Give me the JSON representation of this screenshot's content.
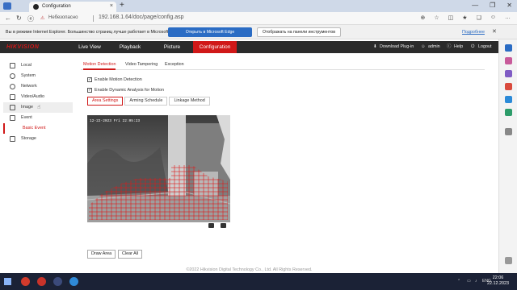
{
  "browser": {
    "tab_title": "Configuration",
    "tab_close": "×",
    "new_tab": "+",
    "window_controls": [
      "—",
      "❐",
      "✕"
    ],
    "security_label": "Небезопасно",
    "url": "192.168.1.64/doc/page/config.asp"
  },
  "ie_infobar": {
    "message": "Вы в режиме Internet Explorer. Большинство страниц лучше работает в Microsoft Edge.",
    "open_in_edge": "Открыть в Microsoft Edge",
    "show_on_toolbar": "Отображать на панели инструментов",
    "more_link": "Подробнее",
    "close": "✕"
  },
  "app": {
    "logo": "HIKVISION",
    "menu": [
      {
        "label": "Live View"
      },
      {
        "label": "Playback"
      },
      {
        "label": "Picture"
      },
      {
        "label": "Configuration"
      }
    ],
    "right": {
      "download_plugin": "Download Plug-in",
      "user": "admin",
      "help": "Help",
      "logout": "Logout"
    },
    "sidebar": [
      {
        "label": "Local"
      },
      {
        "label": "System"
      },
      {
        "label": "Network"
      },
      {
        "label": "Video/Audio"
      },
      {
        "label": "Image"
      },
      {
        "label": "Event"
      },
      {
        "label": "Basic Event"
      },
      {
        "label": "Storage"
      }
    ],
    "tabs": [
      {
        "label": "Motion Detection"
      },
      {
        "label": "Video Tampering"
      },
      {
        "label": "Exception"
      }
    ],
    "enable_motion_detection": "Enable Motion Detection",
    "enable_dynamic_analysis": "Enable Dynamic Analysis for Motion",
    "subtabs": [
      {
        "label": "Area Settings"
      },
      {
        "label": "Arming Schedule"
      },
      {
        "label": "Linkage Method"
      }
    ],
    "video_timestamp": "12-22-2023 Fri 22:05:23",
    "buttons": {
      "draw_area": "Draw Area",
      "clear_all": "Clear All"
    },
    "footer": "©2022 Hikvision Digital Technology Co., Ltd. All Rights Reserved."
  },
  "taskbar": {
    "language": "ENG",
    "time": "22:06",
    "date": "22.12.2023"
  },
  "colors": {
    "accent": "#d01818",
    "navbar": "#2b2b2b",
    "edge_blue": "#2b6cc4"
  }
}
